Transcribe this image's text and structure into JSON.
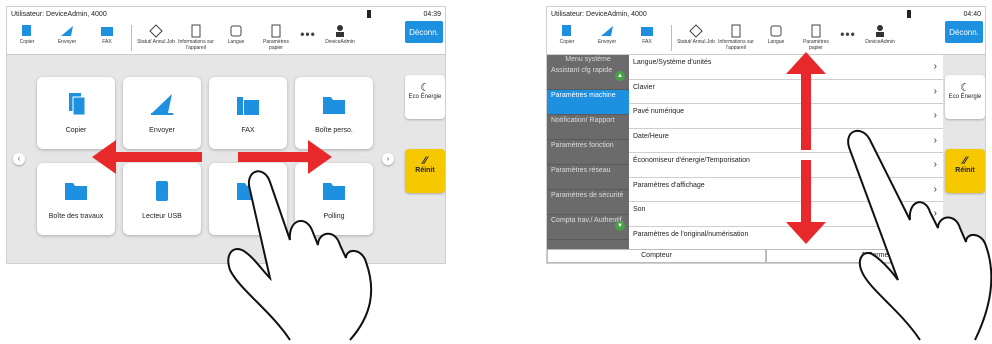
{
  "left": {
    "status": {
      "user": "Utilisateur: DeviceAdmin, 4000",
      "time": "04:39"
    },
    "toolbar": [
      {
        "label": "Copier",
        "icon": "copy-icon"
      },
      {
        "label": "Envoyer",
        "icon": "send-icon"
      },
      {
        "label": "FAX",
        "icon": "fax-icon"
      },
      {
        "label": "Statut/ Annul.Job",
        "icon": "status-icon"
      },
      {
        "label": "Informations sur l'appareil",
        "icon": "info-icon"
      },
      {
        "label": "Langue",
        "icon": "language-icon"
      },
      {
        "label": "Paramètres papier",
        "icon": "paper-icon"
      }
    ],
    "user_label": "DeviceAdmin",
    "logout": "Déconn.",
    "tiles": [
      "Copier",
      "Envoyer",
      "FAX",
      "Boîte perso.",
      "Boîte des travaux",
      "Lecteur USB",
      "",
      "Polling"
    ],
    "eco": "Eco Énergie",
    "reset": "Réinit"
  },
  "right": {
    "status": {
      "user": "Utilisateur: DeviceAdmin, 4000",
      "time": "04:40"
    },
    "toolbar": [
      {
        "label": "Copier",
        "icon": "copy-icon"
      },
      {
        "label": "Envoyer",
        "icon": "send-icon"
      },
      {
        "label": "FAX",
        "icon": "fax-icon"
      },
      {
        "label": "Statut/ Annul.Job",
        "icon": "status-icon"
      },
      {
        "label": "Informations sur l'appareil",
        "icon": "info-icon"
      },
      {
        "label": "Langue",
        "icon": "language-icon"
      },
      {
        "label": "Paramètres papier",
        "icon": "paper-icon"
      }
    ],
    "user_label": "DeviceAdmin",
    "logout": "Déconn.",
    "menu_title": "Menu système",
    "menu": [
      "Assistant cfg rapide",
      "Paramètres machine",
      "Notification/ Rapport",
      "Paramètres fonction",
      "Paramètres réseau",
      "Paramètres de sécurité",
      "Compta trav./ Authentif."
    ],
    "list": [
      "Langue/Système d'unités",
      "Clavier",
      "Pavé numérique",
      "Date/Heure",
      "Économiseur d'énergie/Temporisation",
      "Paramètres d'affichage",
      "Son",
      "Paramètres de l'original/numérisation"
    ],
    "counter": "Compteur",
    "close": "Fermer",
    "eco": "Eco Énergie",
    "reset": "Réinit"
  },
  "colors": {
    "accent": "#1e90e0",
    "arrow": "#e8292b",
    "reset": "#f5c800"
  }
}
